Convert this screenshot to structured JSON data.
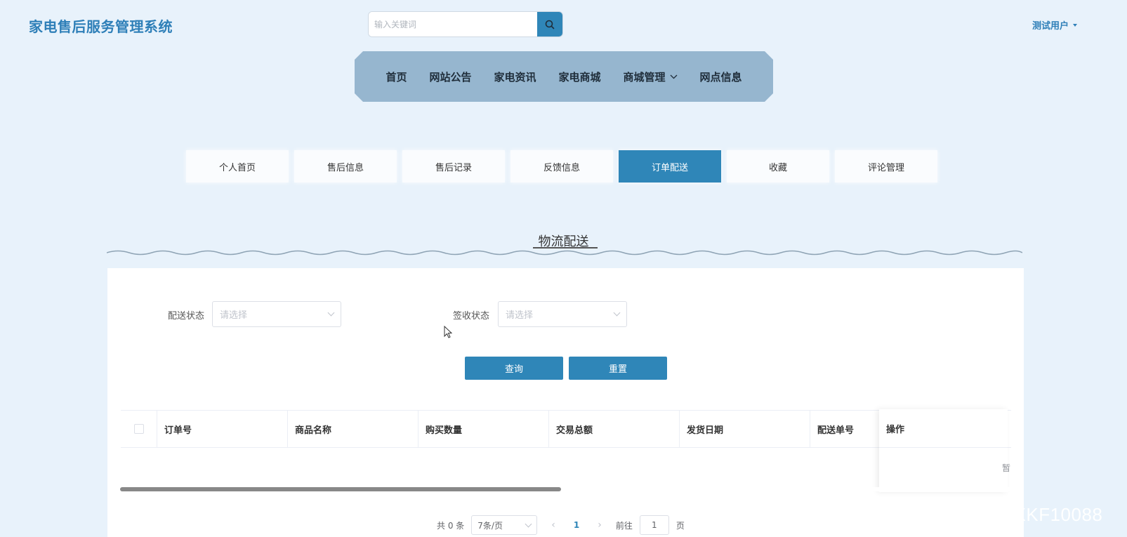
{
  "header": {
    "site_title": "家电售后服务管理系统",
    "search_placeholder": "输入关键词",
    "user_label": "测试用户"
  },
  "nav": {
    "items": [
      "首页",
      "网站公告",
      "家电资讯",
      "家电商城",
      "商城管理",
      "网点信息"
    ]
  },
  "tabs": {
    "items": [
      "个人首页",
      "售后信息",
      "售后记录",
      "反馈信息",
      "订单配送",
      "收藏",
      "评论管理"
    ],
    "active": "订单配送"
  },
  "section": {
    "title": "物流配送"
  },
  "filters": {
    "delivery_status_label": "配送状态",
    "delivery_status_placeholder": "请选择",
    "sign_status_label": "签收状态",
    "sign_status_placeholder": "请选择",
    "query_label": "查询",
    "reset_label": "重置"
  },
  "table": {
    "columns": [
      "订单号",
      "商品名称",
      "购买数量",
      "交易总额",
      "发货日期",
      "配送单号",
      "操作"
    ],
    "empty_text": "暂"
  },
  "pagination": {
    "total": "共 0 条",
    "page_size": "7条/页",
    "current_page": "1",
    "goto_label": "前往",
    "goto_value": "1",
    "page_suffix": "页"
  },
  "watermark": "CSDN @vx_CXKF10088",
  "colors": {
    "accent": "#2f86b8",
    "nav_bg": "#96b6cf",
    "page_bg": "#e8f2fb"
  }
}
